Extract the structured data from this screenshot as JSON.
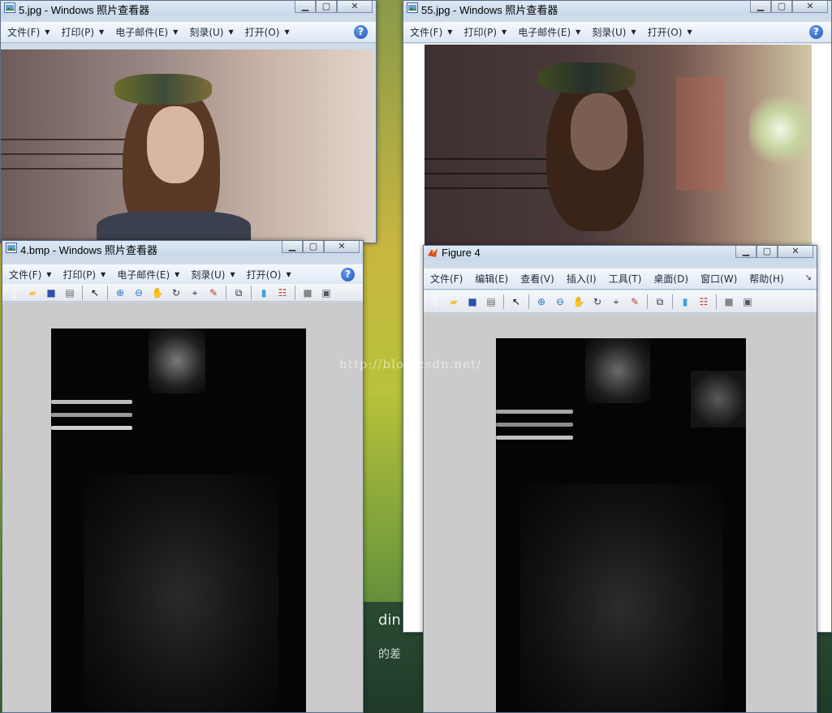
{
  "windows": {
    "w1": {
      "title": "5.jpg - Windows 照片查看器"
    },
    "w2": {
      "title": "55.jpg - Windows 照片查看器"
    },
    "w3": {
      "title": "4.bmp - Windows 照片查看器"
    },
    "w4": {
      "title": "Figure 4"
    }
  },
  "photo_viewer_menu": [
    {
      "label": "文件(F)"
    },
    {
      "label": "打印(P)"
    },
    {
      "label": "电子邮件(E)"
    },
    {
      "label": "刻录(U)"
    },
    {
      "label": "打开(O)"
    }
  ],
  "figure_menu": [
    {
      "label": "文件(F)"
    },
    {
      "label": "编辑(E)"
    },
    {
      "label": "查看(V)"
    },
    {
      "label": "插入(I)"
    },
    {
      "label": "工具(T)"
    },
    {
      "label": "桌面(D)"
    },
    {
      "label": "窗口(W)"
    },
    {
      "label": "帮助(H)"
    }
  ],
  "watermark": "http://blog.csdn.net/",
  "taskbar_fragments": {
    "text1": "din",
    "text2": "的差"
  },
  "icons": {
    "help": "help-icon",
    "minimize": "minimize-icon",
    "maximize": "maximize-icon",
    "close": "close-icon"
  }
}
